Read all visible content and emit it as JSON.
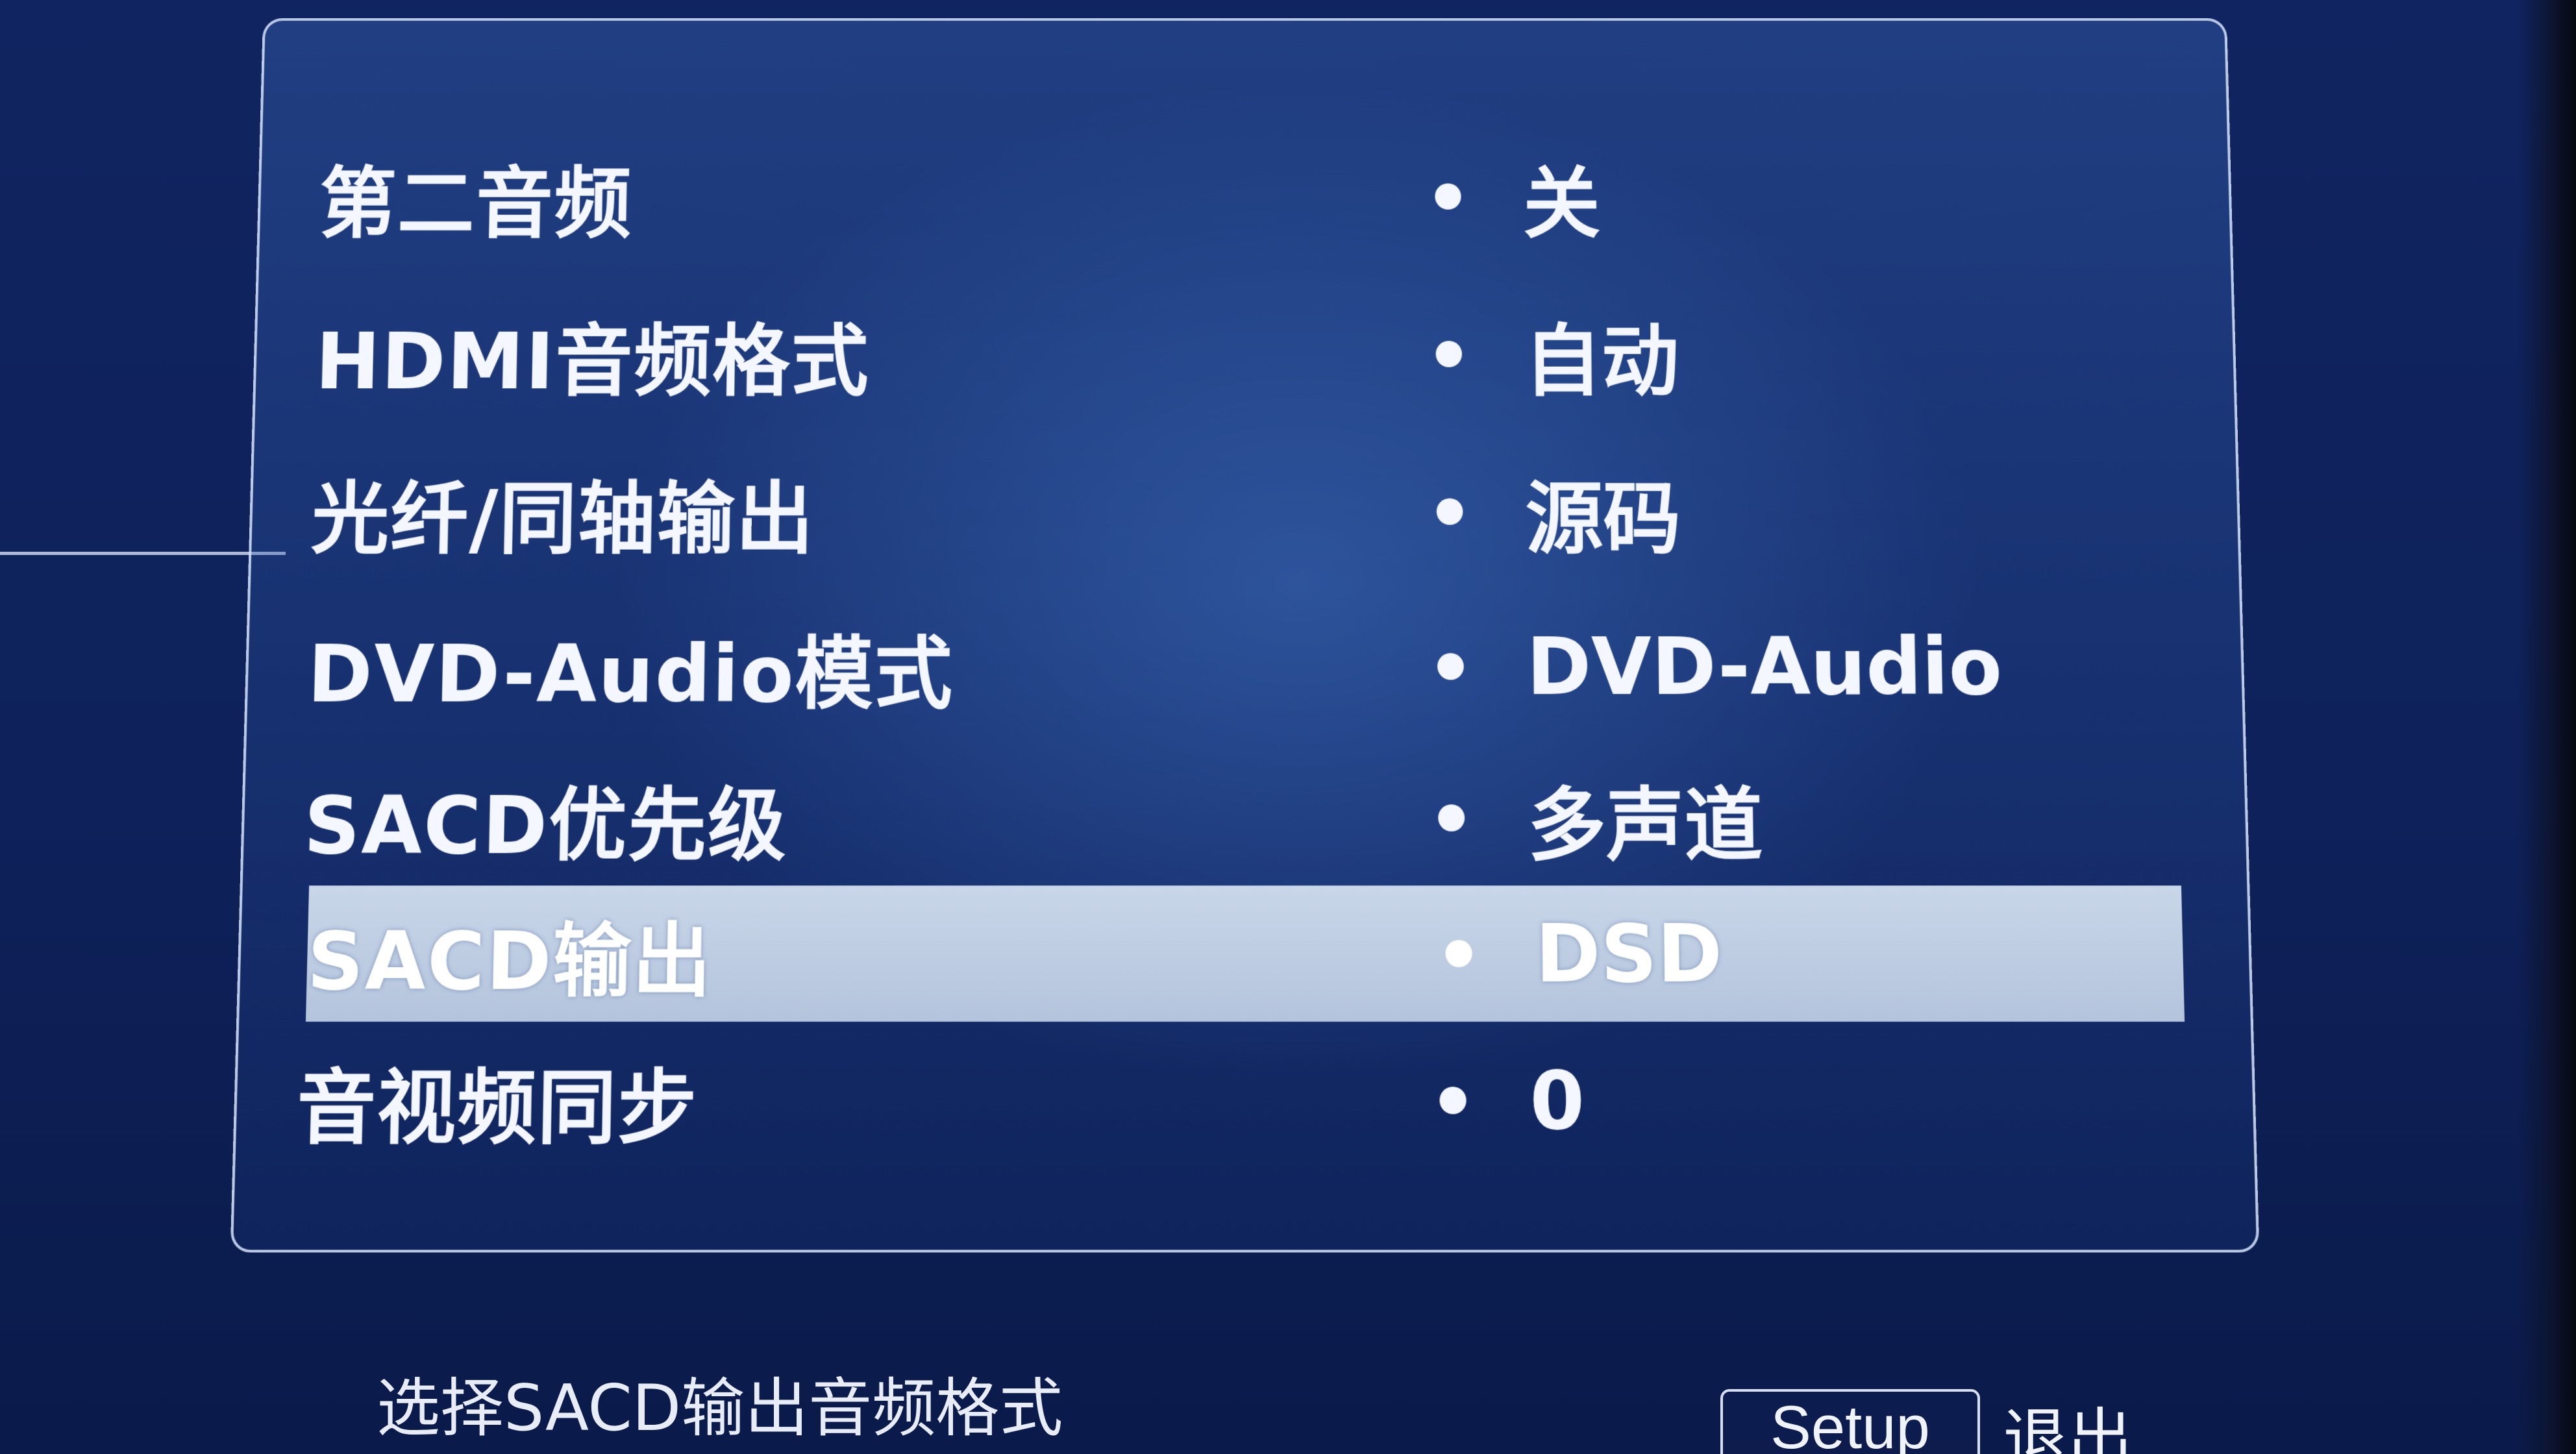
{
  "menu": {
    "items": [
      {
        "label": "第二音频",
        "value": "关"
      },
      {
        "label": "HDMI音频格式",
        "value": "自动"
      },
      {
        "label": "光纤/同轴输出",
        "value": "源码"
      },
      {
        "label": "DVD-Audio模式",
        "value": "DVD-Audio"
      },
      {
        "label": "SACD优先级",
        "value": "多声道"
      },
      {
        "label": "SACD输出",
        "value": "DSD"
      },
      {
        "label": "音视频同步",
        "value": "0"
      }
    ],
    "selected_label": "SACD输出"
  },
  "footer": {
    "hint": "选择SACD输出音频格式",
    "setup_key": "Setup",
    "exit_label": "退出"
  },
  "colors": {
    "background": "#0e215a",
    "highlight": "#c2d0e6",
    "text": "#f4f7ff"
  }
}
